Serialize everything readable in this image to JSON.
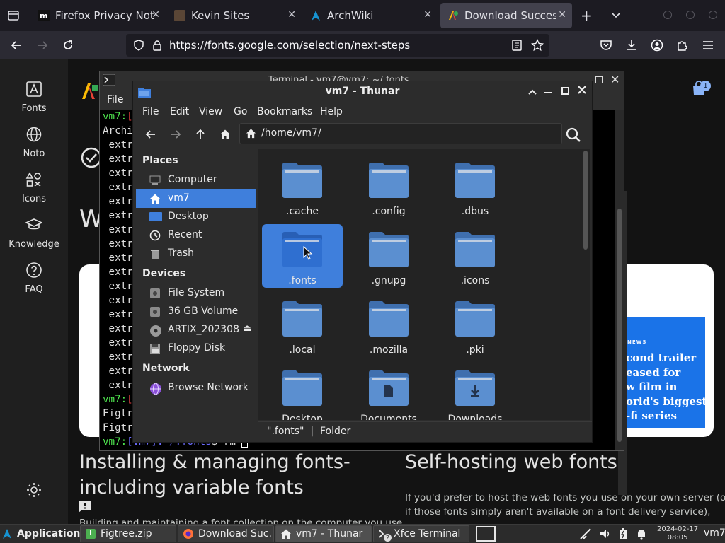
{
  "browser": {
    "tabs": [
      {
        "title": "Firefox Privacy Noti",
        "close": "✕"
      },
      {
        "title": "Kevin Sites",
        "close": "✕"
      },
      {
        "title": "ArchWiki",
        "close": "✕"
      },
      {
        "title": "Download Success",
        "close": "✕"
      }
    ],
    "new_tab": "+",
    "url": "https://fonts.google.com/selection/next-steps",
    "extension_badge": "1"
  },
  "google_fonts": {
    "nav": [
      {
        "label": "Fonts",
        "icon": "font-icon"
      },
      {
        "label": "Noto",
        "icon": "globe-icon"
      },
      {
        "label": "Icons",
        "icon": "shapes-icon"
      },
      {
        "label": "Knowledge",
        "icon": "school-icon"
      },
      {
        "label": "FAQ",
        "icon": "help-icon"
      }
    ],
    "heading_partial": "W",
    "card": {
      "kicker": "NEWS",
      "headline": "cond trailer\neased for\nw film in\norld's biggest\n-fi series"
    },
    "section_left": {
      "title_line1": "Installing & managing fonts-",
      "title_line2": "including variable fonts",
      "body": "Building and maintaining a font collection on the computer you use"
    },
    "section_right": {
      "title": "Self-hosting web fonts",
      "body_line1": "If you'd prefer to host the web fonts you use on your own server (or",
      "body_line2": "if those fonts simply aren't available on a font delivery service),"
    }
  },
  "terminal": {
    "title": "Terminal - vm7@vm7: ~/.fonts",
    "menu_file": "File",
    "lines": [
      {
        "a": "vm7",
        "b": ":",
        "c": "["
      },
      {
        "text": "Archi"
      },
      {
        "text": " extr"
      },
      {
        "text": " extr"
      },
      {
        "text": " extr"
      },
      {
        "text": " extr"
      },
      {
        "text": " extr"
      },
      {
        "text": " extr"
      },
      {
        "text": " extr"
      },
      {
        "text": " extr"
      },
      {
        "text": " extr"
      },
      {
        "text": " extr"
      },
      {
        "text": " extr"
      },
      {
        "text": " extr"
      },
      {
        "text": " extr"
      },
      {
        "text": " extr"
      },
      {
        "text": " extr"
      },
      {
        "text": " extr"
      },
      {
        "text": " extr"
      },
      {
        "text": " extr"
      },
      {
        "a": "vm7",
        "b": ":",
        "c": "["
      },
      {
        "text": "Figtr"
      },
      {
        "text": "Figtr"
      }
    ],
    "prompt": {
      "user": "vm7",
      "sep": ":",
      "dir": "[vm7]:~/.fonts",
      "cmd": "$ rm "
    }
  },
  "thunar": {
    "title": "vm7 - Thunar",
    "menu": [
      "File",
      "Edit",
      "View",
      "Go",
      "Bookmarks",
      "Help"
    ],
    "path": "/home/vm7/",
    "sidebar": {
      "places_header": "Places",
      "places": [
        {
          "label": "Computer",
          "icon": "computer-icon"
        },
        {
          "label": "vm7",
          "icon": "home-icon"
        },
        {
          "label": "Desktop",
          "icon": "desktop-icon"
        },
        {
          "label": "Recent",
          "icon": "clock-icon"
        },
        {
          "label": "Trash",
          "icon": "trash-icon"
        }
      ],
      "devices_header": "Devices",
      "devices": [
        {
          "label": "File System",
          "icon": "drive-icon"
        },
        {
          "label": "36 GB Volume",
          "icon": "drive-icon"
        },
        {
          "label": "ARTIX_202308",
          "icon": "disc-icon"
        },
        {
          "label": "Floppy Disk",
          "icon": "floppy-icon"
        }
      ],
      "eject": "⏏",
      "network_header": "Network",
      "network": [
        {
          "label": "Browse Network",
          "icon": "network-icon"
        }
      ]
    },
    "files": [
      {
        "name": ".cache"
      },
      {
        "name": ".config"
      },
      {
        "name": ".dbus"
      },
      {
        "name": ".fonts"
      },
      {
        "name": ".gnupg"
      },
      {
        "name": ".icons"
      },
      {
        "name": ".local"
      },
      {
        "name": ".mozilla"
      },
      {
        "name": ".pki"
      },
      {
        "name": "Desktop"
      },
      {
        "name": "Documents"
      },
      {
        "name": "Downloads"
      }
    ],
    "selected_file": ".fonts",
    "status": "\".fonts\"  |  Folder"
  },
  "taskbar": {
    "applications": "Applications",
    "tasks": [
      "Figtree.zip",
      "Download Suc...",
      "vm7 - Thunar",
      "Xfce Terminal"
    ],
    "date": "2024-02-17",
    "time": "08:05",
    "user": "vm7",
    "terminal_count": "2"
  },
  "colors": {
    "accent": "#3f7fdc",
    "folder": "#5b8fd0",
    "folder_dark": "#3f6fae",
    "prompt_green": "#4ee44e",
    "prompt_red": "#e44444",
    "link_blue": "#1a73e8"
  }
}
